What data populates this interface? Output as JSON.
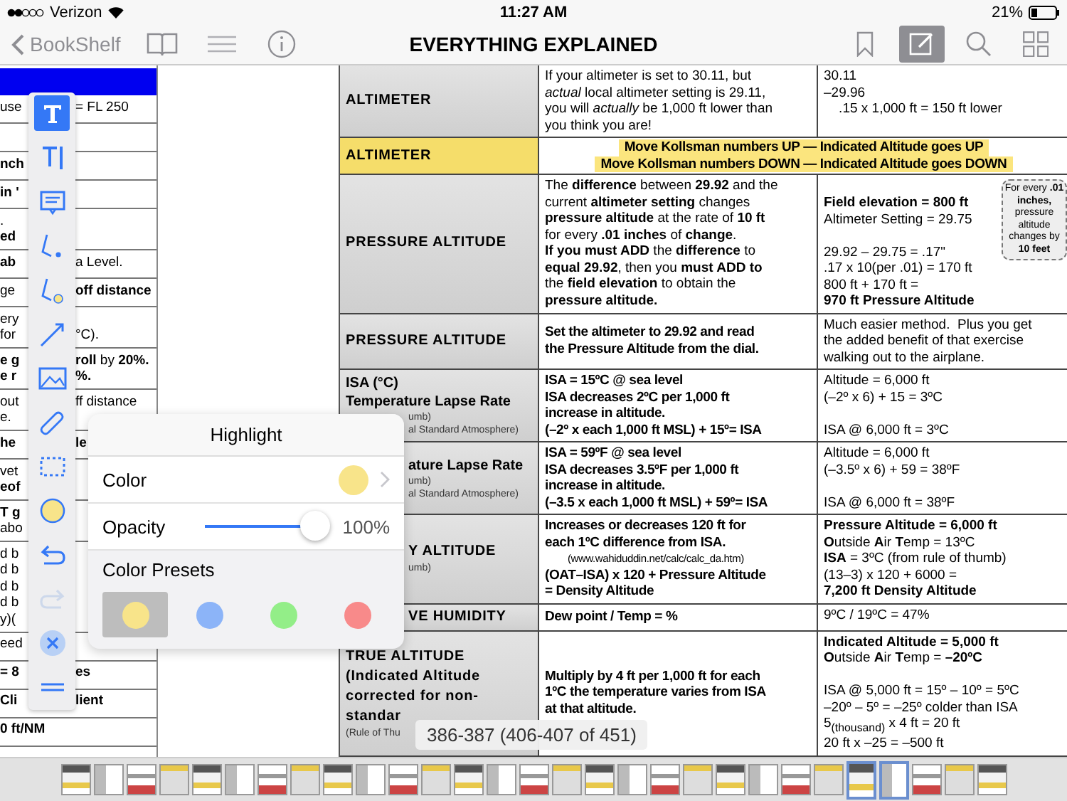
{
  "status_bar": {
    "carrier": "Verizon",
    "time": "11:27 AM",
    "battery": "21%"
  },
  "nav": {
    "back": "BookShelf",
    "title": "EVERYTHING EXPLAINED",
    "left_icons": [
      {
        "kind": "book"
      },
      {
        "kind": "list"
      },
      {
        "kind": "info"
      }
    ],
    "right_icons": [
      {
        "kind": "bookmark",
        "selected": false
      },
      {
        "kind": "annotate",
        "selected": true
      },
      {
        "kind": "search",
        "selected": false
      },
      {
        "kind": "grid",
        "selected": false
      }
    ]
  },
  "left_page": {
    "rows": [
      {
        "lines": [
          {
            "a": "use",
            "b": "= FL 250"
          }
        ]
      },
      {
        "lines": []
      },
      {
        "lines": [
          {
            "a": "**nch**"
          }
        ]
      },
      {
        "lines": [
          {
            "a": "**in '**"
          }
        ]
      },
      {
        "lines": [
          {
            "a": "."
          },
          {
            "a": "**ed**"
          }
        ]
      },
      {
        "lines": [
          {
            "a": "**ab**",
            "b": "a Level."
          }
        ]
      },
      {
        "lines": [
          {
            "a": "ge",
            "b": "**off distance**"
          }
        ]
      },
      {
        "lines": [
          {
            "a": "ery"
          },
          {
            "a": "for",
            "b": "°C)."
          }
        ]
      },
      {
        "lines": [
          {
            "a": "**e g**",
            "b": "**roll** by **20%.**"
          },
          {
            "a": "**e r**",
            "b": "**%.**"
          }
        ]
      },
      {
        "lines": [
          {
            "a": "out",
            "b": "ff distance"
          },
          {
            "a": "e."
          }
        ]
      },
      {
        "lines": [
          {
            "a": "**he**",
            "b": "**le**"
          }
        ]
      },
      {
        "lines": [
          {
            "a": "vet"
          },
          {
            "a": "**eof**"
          }
        ]
      },
      {
        "lines": [
          {
            "a": "**T g**"
          },
          {
            "a": "abo"
          }
        ]
      },
      {
        "lines": [
          {
            "a": "d b"
          },
          {
            "a": "d b"
          },
          {
            "a": "d b"
          },
          {
            "a": "d b"
          },
          {
            "a": "y)("
          }
        ]
      },
      {
        "lines": [
          {
            "a": "eed"
          }
        ]
      },
      {
        "lines": [
          {
            "a": "**= 8**",
            "b": "**es**"
          }
        ]
      },
      {
        "lines": [
          {
            "a": "**Cli**",
            "b": "**lient**"
          }
        ]
      },
      {
        "lines": [
          {
            "a": "**0 ft/NM**"
          }
        ]
      }
    ]
  },
  "table": {
    "rows": [
      {
        "highlighted": false,
        "head": [
          {
            "text": "ALTIMETER",
            "kind": "title"
          }
        ],
        "cells": [
          {
            "kind": "explanation",
            "lines": [
              "If your altimeter is set to 30.11, but",
              "*actual* local altimeter setting is 29.11,",
              "you will *actually* be 1,000 ft lower than",
              "you think you are!"
            ]
          },
          {
            "kind": "example",
            "lines": [
              "30.11",
              "–29.96",
              "    .15 x 1,000 ft = 150 ft lower"
            ]
          }
        ]
      },
      {
        "highlighted": true,
        "head": [
          {
            "text": "ALTIMETER",
            "kind": "title"
          }
        ],
        "cells": [
          {
            "kind": "rule",
            "lines": [
              "Move Kollsman numbers UP — Indicated Altitude goes UP",
              "Move Kollsman numbers DOWN — Indicated Altitude goes DOWN"
            ]
          }
        ]
      },
      {
        "highlighted": false,
        "head": [
          {
            "text": "PRESSURE ALTITUDE",
            "kind": "title"
          }
        ],
        "cells": [
          {
            "kind": "explanation",
            "lines": [
              "The **difference** between **29.92** and the",
              "current **altimeter setting** changes",
              "**pressure altitude** at the rate of **10 ft**",
              "for every **.01 inches** of **change**.",
              "**If you must ADD** the **difference** to",
              "**equal 29.92**, then you **must ADD to**",
              "the **field elevation** to obtain the",
              "**pressure altitude.**"
            ]
          },
          {
            "kind": "example",
            "callout": "For every **.01 inches,** pressure altitude changes by **10 feet**",
            "paragraphs": [
              [
                "**Field elevation = 800 ft**",
                "Altimeter Setting = 29.75"
              ],
              [
                "29.92 – 29.75 = .17\"",
                ".17 x 10(per .01) = 170 ft",
                "800 ft + 170 ft =",
                "**970 ft Pressure Altitude**"
              ]
            ]
          }
        ]
      },
      {
        "highlighted": false,
        "head": [
          {
            "text": "PRESSURE ALTITUDE",
            "kind": "title"
          }
        ],
        "cells": [
          {
            "kind": "rule",
            "lines": [
              "Set the altimeter to 29.92 and read",
              "the Pressure Altitude from the dial."
            ]
          },
          {
            "kind": "example",
            "lines": [
              "Much easier method.  Plus you get",
              "the added benefit of that exercise",
              "walking out to the airplane."
            ]
          }
        ]
      },
      {
        "highlighted": false,
        "head": [
          {
            "text": "ISA (°C)",
            "kind": "subtitle"
          },
          {
            "text": "Temperature Lapse Rate",
            "kind": "subtitle"
          }
        ],
        "head_tail": [
          {
            "text": "umb)",
            "kind": "note"
          },
          {
            "text": "al Standard Atmosphere)",
            "kind": "note"
          }
        ],
        "cells": [
          {
            "kind": "rule",
            "lines": [
              "ISA = 15ºC @ sea level",
              "ISA decreases 2ºC per 1,000 ft",
              "increase in altitude.",
              "(–2º x each 1,000 ft MSL) + 15º= ISA"
            ]
          },
          {
            "kind": "example",
            "paragraphs": [
              [
                "Altitude = 6,000 ft",
                "(–2º x 6) + 15 = 3ºC"
              ],
              [
                "ISA @ 6,000 ft = 3ºC"
              ]
            ]
          }
        ]
      },
      {
        "highlighted": false,
        "head_tail": [
          {
            "text": "ature Lapse Rate",
            "kind": "subtitle"
          },
          {
            "text": "umb)",
            "kind": "note"
          },
          {
            "text": "al Standard Atmosphere)",
            "kind": "note"
          }
        ],
        "cells": [
          {
            "kind": "rule",
            "lines": [
              "ISA = 59ºF @ sea level",
              "ISA decreases 3.5ºF per 1,000 ft",
              "increase in altitude.",
              "(–3.5 x each 1,000 ft MSL) + 59º= ISA"
            ]
          },
          {
            "kind": "example",
            "paragraphs": [
              [
                "Altitude = 6,000 ft",
                "(–3.5º x 6) + 59 = 38ºF"
              ],
              [
                "ISA @ 6,000 ft = 38ºF"
              ]
            ]
          }
        ]
      },
      {
        "highlighted": false,
        "head_tail": [
          {
            "text": "Y ALTITUDE",
            "kind": "title"
          },
          {
            "text": "umb)",
            "kind": "note"
          }
        ],
        "cells": [
          {
            "kind": "rule",
            "lines": [
              "Increases or decreases 120 ft for",
              "each 1ºC difference from ISA.",
              {
                "text": "(www.wahiduddin.net/calc/calc_da.htm)",
                "kind": "link"
              },
              "(OAT–ISA) x 120 + Pressure Altitude",
              "= Density Altitude"
            ]
          },
          {
            "kind": "example",
            "lines": [
              "**Pressure Altitude = 6,000 ft**",
              "**O**utside **A**ir **T**emp = 13ºC",
              "**ISA** = 3ºC (from rule of thumb)",
              "(13–3) x 120 + 6000 =",
              "**7,200 ft Density Altitude**"
            ]
          }
        ]
      },
      {
        "highlighted": false,
        "head_tail": [
          {
            "text": "VE HUMIDITY",
            "kind": "title"
          }
        ],
        "cells": [
          {
            "kind": "rule",
            "lines": [
              "Dew point / Temp = %"
            ]
          },
          {
            "kind": "example",
            "lines": [
              "9ºC / 19ºC = 47%"
            ]
          }
        ]
      },
      {
        "highlighted": false,
        "head": [
          {
            "text": "TRUE ALTITUDE",
            "kind": "title"
          },
          {
            "text": "(Indicated Altitude",
            "kind": "title"
          },
          {
            "text": "corrected for non-",
            "kind": "title"
          },
          {
            "text": "standar",
            "kind": "title"
          },
          {
            "text": "(Rule of Thu",
            "kind": "note"
          }
        ],
        "cells": [
          {
            "kind": "rule",
            "lines": [
              "Multiply by 4 ft per 1,000 ft for each",
              "1ºC the temperature varies from ISA",
              "at that altitude."
            ]
          },
          {
            "kind": "example",
            "paragraphs": [
              [
                "**Indicated Altitude = 5,000 ft**",
                "**O**utside **A**ir **T**emp = **–20ºC**"
              ],
              [
                "ISA @ 5,000 ft = 15º – 10º = 5ºC",
                "–20º – 5º = –25º colder than ISA",
                "5$_{(thousand)}$ x 4 ft = 20 ft",
                "20 ft x –25 = –500 ft"
              ]
            ]
          }
        ]
      }
    ]
  },
  "toolbar": [
    {
      "kind": "text",
      "selected": true,
      "disabled": false
    },
    {
      "kind": "text-insert",
      "selected": false,
      "disabled": false
    },
    {
      "kind": "note",
      "selected": false,
      "disabled": false
    },
    {
      "kind": "pen",
      "selected": false,
      "disabled": false
    },
    {
      "kind": "highlight-pen",
      "selected": false,
      "disabled": false
    },
    {
      "kind": "line",
      "selected": false,
      "disabled": false
    },
    {
      "kind": "image",
      "selected": false,
      "disabled": false
    },
    {
      "kind": "eraser",
      "selected": false,
      "disabled": false
    },
    {
      "kind": "select",
      "selected": false,
      "disabled": false
    },
    {
      "kind": "highlight",
      "selected": false,
      "disabled": false
    },
    {
      "kind": "undo",
      "selected": false,
      "disabled": false
    },
    {
      "kind": "redo",
      "selected": false,
      "disabled": true
    },
    {
      "kind": "clear",
      "selected": false,
      "disabled": false
    },
    {
      "kind": "handle",
      "selected": false,
      "disabled": false
    }
  ],
  "popup": {
    "title": "Highlight",
    "color_label": "Color",
    "color": "#f8e48a",
    "opacity_label": "Opacity",
    "opacity": {
      "level": 1,
      "reading": "100%"
    },
    "presets_label": "Color Presets",
    "presets": [
      {
        "color": "#f8e48a",
        "selected": true
      },
      {
        "color": "#8cb4f8",
        "selected": false
      },
      {
        "color": "#93ee88",
        "selected": false
      },
      {
        "color": "#f88a8a",
        "selected": false
      }
    ]
  },
  "page_label": "386-387 (406-407 of 451)",
  "thumbnails": [
    {
      "selected": false
    },
    {
      "selected": false
    },
    {
      "selected": false
    },
    {
      "selected": false
    },
    {
      "selected": false
    },
    {
      "selected": false
    },
    {
      "selected": false
    },
    {
      "selected": false
    },
    {
      "selected": false
    },
    {
      "selected": false
    },
    {
      "selected": false
    },
    {
      "selected": false
    },
    {
      "selected": false
    },
    {
      "selected": false
    },
    {
      "selected": false
    },
    {
      "selected": false
    },
    {
      "selected": false
    },
    {
      "selected": false
    },
    {
      "selected": false
    },
    {
      "selected": false
    },
    {
      "selected": false
    },
    {
      "selected": false
    },
    {
      "selected": false
    },
    {
      "selected": false
    },
    {
      "selected": true
    },
    {
      "selected": true
    },
    {
      "selected": false
    },
    {
      "selected": false
    },
    {
      "selected": false
    }
  ]
}
